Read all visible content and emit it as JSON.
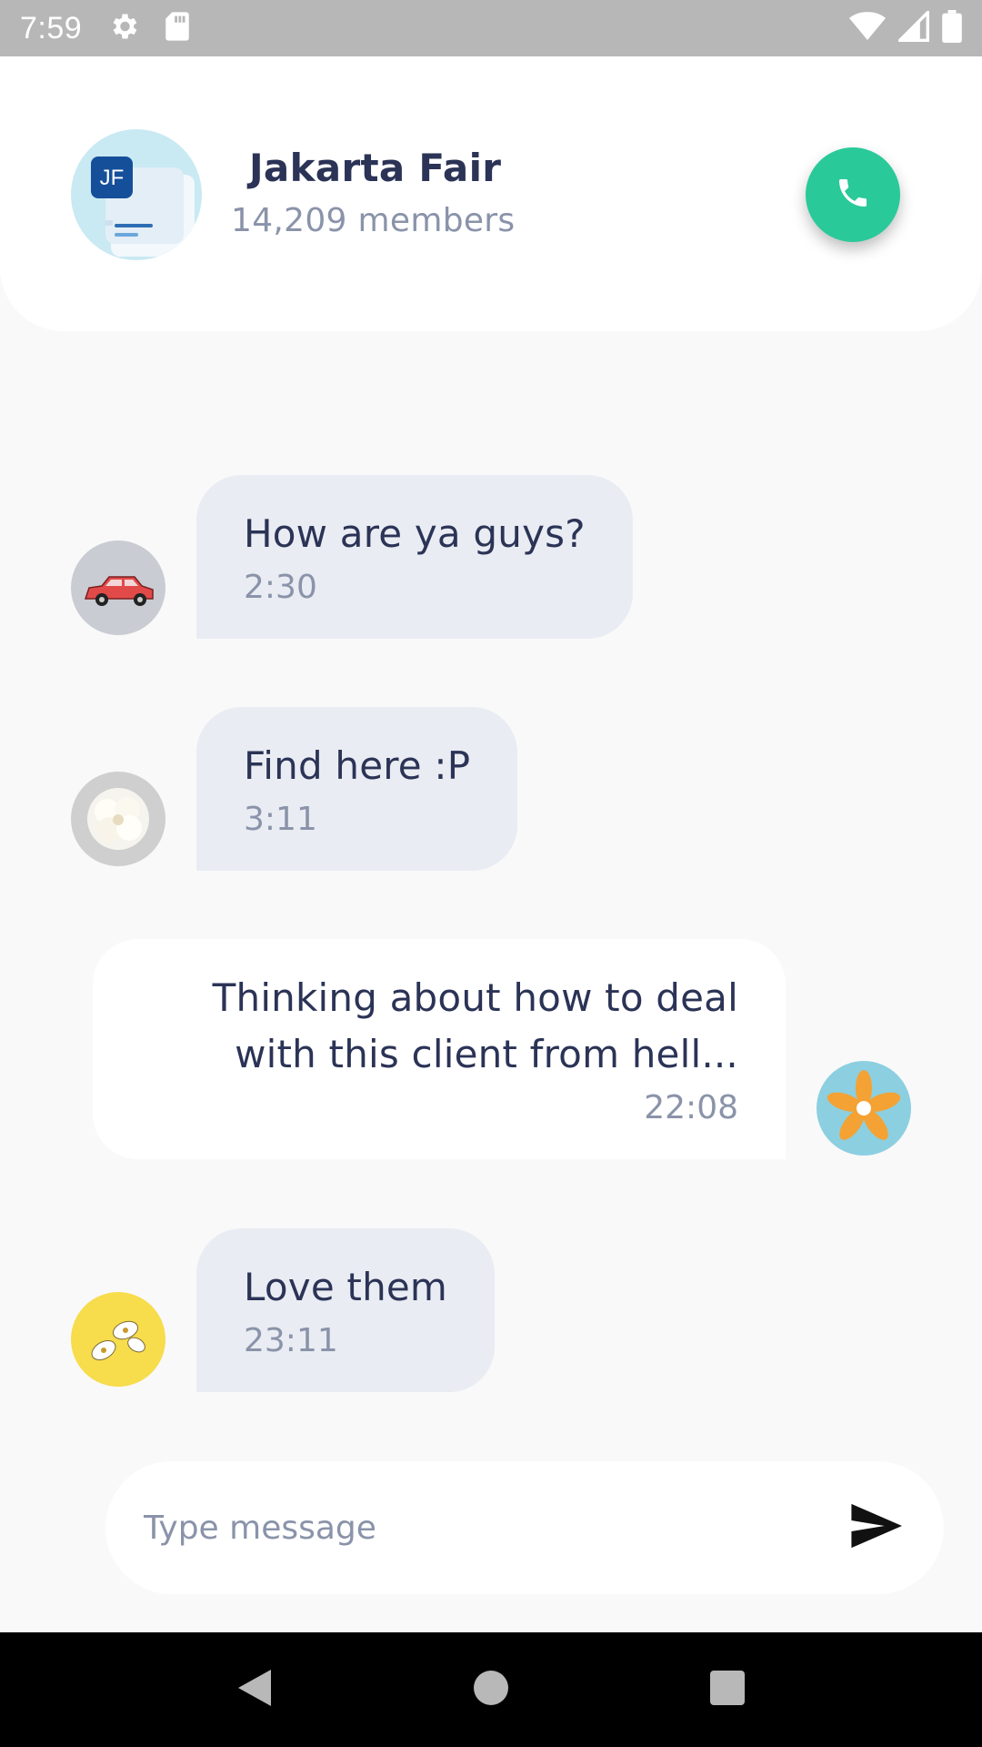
{
  "status_bar": {
    "time": "7:59",
    "icons_left": [
      "settings-icon",
      "sd-card-icon"
    ],
    "icons_right": [
      "wifi-icon",
      "signal-icon",
      "battery-icon"
    ]
  },
  "header": {
    "group_avatar_badge": "JF",
    "title": "Jakarta Fair",
    "members": "14,209 members",
    "call_icon": "phone-icon",
    "accent_color": "#2ac99a"
  },
  "messages": [
    {
      "direction": "in",
      "text": "How are ya guys?",
      "time": "2:30",
      "avatar": "car-avatar"
    },
    {
      "direction": "in",
      "text": "Find here :P",
      "time": "3:11",
      "avatar": "white-flower-avatar"
    },
    {
      "direction": "out",
      "text_lines": [
        "Thinking about how to deal",
        "with this client from hell..."
      ],
      "time": "22:08",
      "avatar": "orange-flower-avatar"
    },
    {
      "direction": "in",
      "text": "Love them",
      "time": "23:11",
      "avatar": "yellow-daisy-avatar"
    }
  ],
  "composer": {
    "placeholder": "Type message",
    "value": "",
    "send_icon": "send-icon"
  },
  "nav_bar": {
    "icons": [
      "back-icon",
      "home-icon",
      "recents-icon"
    ]
  }
}
